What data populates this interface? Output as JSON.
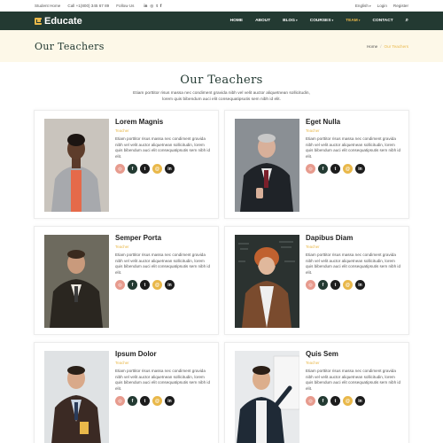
{
  "topbar": {
    "student_home": "Student Home",
    "call": "Call +1(800) 345 67 89",
    "follow": "Follow Us",
    "social_icons": [
      "linkedin-icon",
      "instagram-icon",
      "twitter-icon",
      "facebook-icon"
    ],
    "language": "English",
    "login": "Login",
    "register": "Register"
  },
  "nav": {
    "brand": "Educate",
    "items": [
      {
        "label": "HOME",
        "dropdown": false,
        "active": false
      },
      {
        "label": "ABOUT",
        "dropdown": false,
        "active": false
      },
      {
        "label": "BLOG",
        "dropdown": true,
        "active": false
      },
      {
        "label": "COURSES",
        "dropdown": true,
        "active": false
      },
      {
        "label": "TEAM",
        "dropdown": true,
        "active": true
      },
      {
        "label": "CONTACT",
        "dropdown": false,
        "active": false
      }
    ]
  },
  "page_header": {
    "title": "Our Teachers",
    "breadcrumb_home": "Home",
    "breadcrumb_sep": "/",
    "breadcrumb_current": "Our Teachers"
  },
  "section": {
    "title": "Our Teachers",
    "description": "Etiam porttitor risus massa nec condiment gravida nibh vel velit auctor aliquetnean sollicitudin, lorem quis bibendum auci elit consequatipsutis sem nibh id elit."
  },
  "teachers": [
    {
      "name": "Lorem Magnis",
      "role": "Teacher",
      "bio": "Etiam porttitor risus massa nec condiment gravida nibh vel velit auctor aliquetnean sollicitudin, lorem quis bibendum auci elit consequatipsutis sem nibh id elit."
    },
    {
      "name": "Eget Nulla",
      "role": "Teacher",
      "bio": "Etiam porttitor risus massa nec condiment gravida nibh vel velit auctor aliquetnean sollicitudin, lorem quis bibendum auci elit consequatipsutis sem nibh id elit."
    },
    {
      "name": "Semper Porta",
      "role": "Teacher",
      "bio": "Etiam porttitor risus massa nec condiment gravida nibh vel velit auctor aliquetnean sollicitudin, lorem quis bibendum auci elit consequatipsutis sem nibh id elit."
    },
    {
      "name": "Dapibus Diam",
      "role": "Teacher",
      "bio": "Etiam porttitor risus massa nec condiment gravida nibh vel velit auctor aliquetnean sollicitudin, lorem quis bibendum auci elit consequatipsutis sem nibh id elit."
    },
    {
      "name": "Ipsum Dolor",
      "role": "Teacher",
      "bio": "Etiam porttitor risus massa nec condiment gravida nibh vel velit auctor aliquetnean sollicitudin, lorem quis bibendum auci elit consequatipsutis sem nibh id elit."
    },
    {
      "name": "Quis Sem",
      "role": "Teacher",
      "bio": "Etiam porttitor risus massa nec condiment gravida nibh vel velit auctor aliquetnean sollicitudin, lorem quis bibendum auci elit consequatipsutis sem nibh id elit."
    }
  ],
  "card_socials": [
    "dribbble-icon",
    "facebook-icon",
    "twitter-icon",
    "email-icon",
    "linkedin-icon"
  ],
  "colors": {
    "primary": "#233a32",
    "accent": "#e9b84a",
    "header_bg": "#fdf8e8",
    "dribbble": "#e79b8e"
  }
}
